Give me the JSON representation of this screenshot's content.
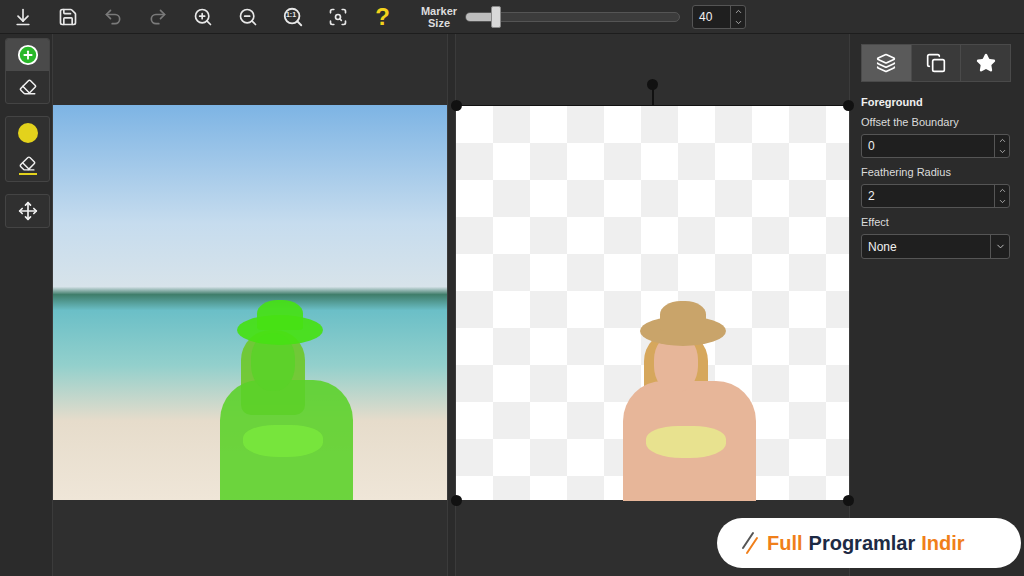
{
  "toolbar": {
    "buttons": [
      {
        "kind": "open",
        "disabled": false
      },
      {
        "kind": "save",
        "disabled": false
      },
      {
        "kind": "undo",
        "disabled": true
      },
      {
        "kind": "redo",
        "disabled": true
      },
      {
        "kind": "zoom-in",
        "disabled": false
      },
      {
        "kind": "zoom-out",
        "disabled": false
      },
      {
        "kind": "actual-size",
        "label": "1:1",
        "disabled": false
      },
      {
        "kind": "fit",
        "disabled": false
      },
      {
        "kind": "help",
        "label": "?",
        "disabled": false
      }
    ],
    "marker_size": {
      "label": "Marker Size",
      "value": "40",
      "level": 0.14
    }
  },
  "tool_groups": [
    [
      {
        "kind": "add-foreground",
        "selected": true
      },
      {
        "kind": "erase-foreground",
        "selected": false
      }
    ],
    [
      {
        "kind": "add-background",
        "selected": false
      },
      {
        "kind": "erase-background",
        "selected": false
      }
    ],
    [
      {
        "kind": "move",
        "selected": false
      }
    ]
  ],
  "panel_tabs": [
    {
      "kind": "foreground",
      "selected": true
    },
    {
      "kind": "background",
      "selected": false
    },
    {
      "kind": "effects",
      "selected": false
    }
  ],
  "settings": {
    "title": "Foreground",
    "fields": [
      {
        "label": "Offset the Boundary",
        "value": "0",
        "kind": "number"
      },
      {
        "label": "Feathering Radius",
        "value": "2",
        "kind": "number"
      },
      {
        "label": "Effect",
        "value": "None",
        "kind": "select"
      }
    ]
  },
  "watermark": {
    "parts": [
      {
        "text": "Full",
        "color": "#f07f1a"
      },
      {
        "text": "Programlar",
        "color": "#1d2a44"
      },
      {
        "text": "Indir",
        "color": "#f07f1a"
      }
    ]
  }
}
